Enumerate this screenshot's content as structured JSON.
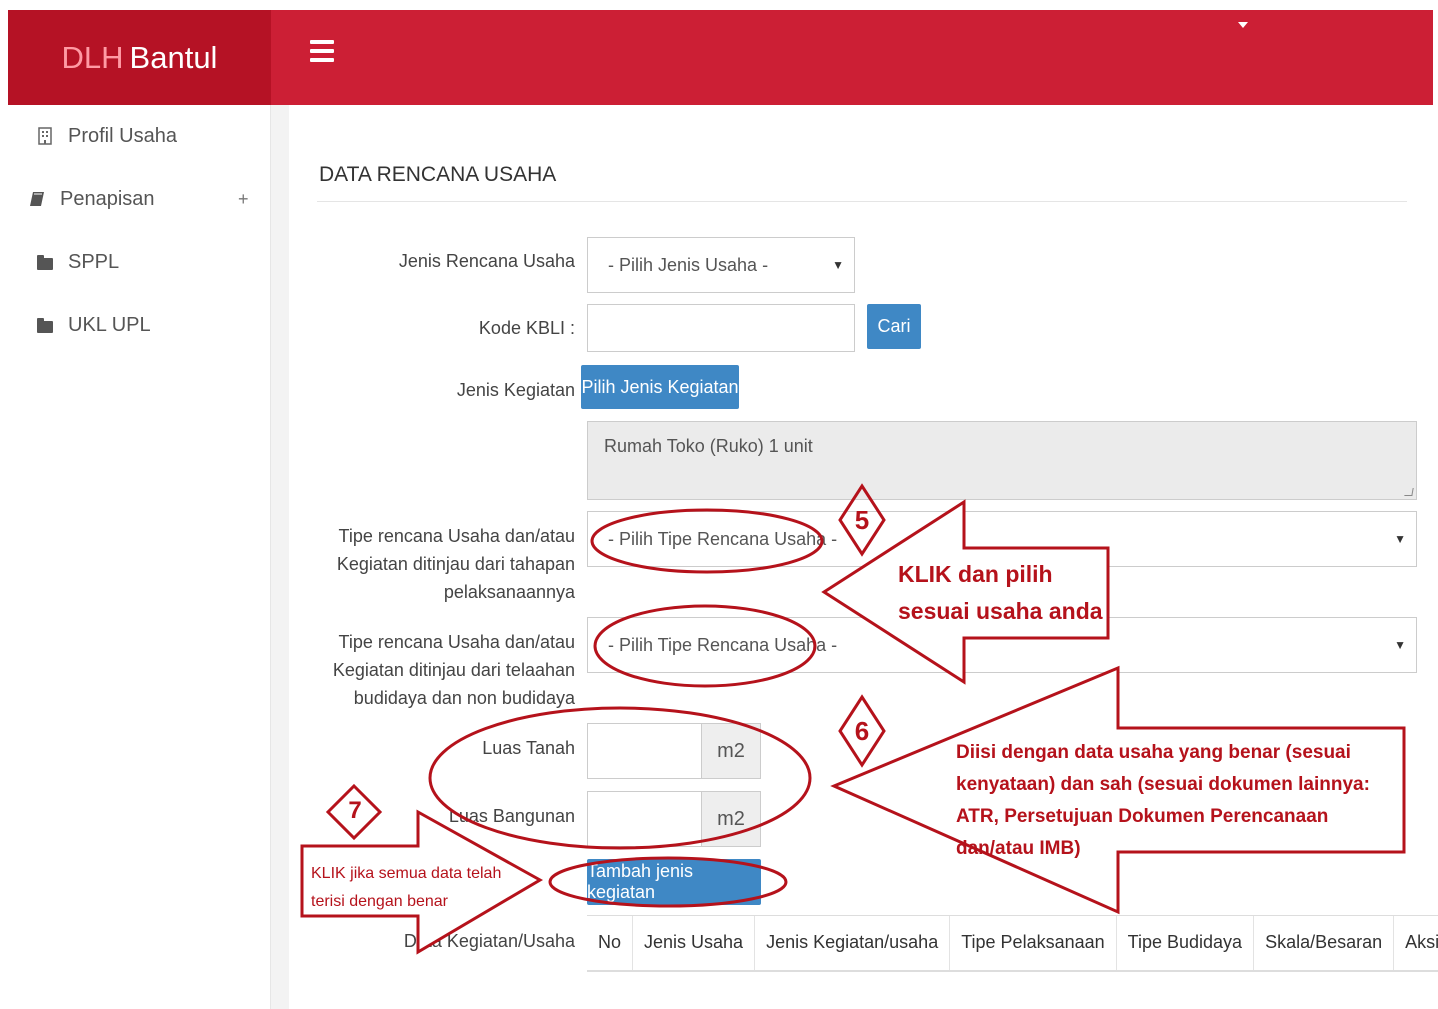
{
  "brand": {
    "part1": "DLH",
    "part2": "Bantul"
  },
  "sidebar": {
    "items": [
      {
        "label": "Profil Usaha",
        "icon": "building-icon"
      },
      {
        "label": "Penapisan",
        "icon": "book-icon",
        "expand": "+"
      },
      {
        "label": "SPPL",
        "icon": "folder-icon"
      },
      {
        "label": "UKL UPL",
        "icon": "folder-icon"
      }
    ]
  },
  "main": {
    "title": "DATA RENCANA USAHA",
    "jenis_rencana": {
      "label": "Jenis Rencana Usaha",
      "value": "- Pilih Jenis Usaha -"
    },
    "kode_kbli": {
      "label": "Kode KBLI :",
      "value": "",
      "button": "Cari"
    },
    "jenis_kegiatan": {
      "label": "Jenis Kegiatan",
      "button": "Pilih Jenis Kegiatan",
      "textarea": "Rumah Toko (Ruko) 1 unit"
    },
    "tipe_tahapan": {
      "label": "Tipe rencana Usaha dan/atau Kegiatan ditinjau dari tahapan pelaksanaannya",
      "value": "- Pilih Tipe Rencana Usaha -"
    },
    "tipe_telaahan": {
      "label": "Tipe rencana Usaha dan/atau Kegiatan ditinjau dari telaahan budidaya dan non budidaya",
      "value": "- Pilih Tipe Rencana Usaha -"
    },
    "luas_tanah": {
      "label": "Luas Tanah",
      "value": "",
      "unit": "m2"
    },
    "luas_bangunan": {
      "label": "Luas Bangunan",
      "value": "",
      "unit": "m2"
    },
    "add_button": "Tambah jenis kegiatan",
    "table": {
      "label": "Data Kegiatan/Usaha",
      "headers": [
        "No",
        "Jenis Usaha",
        "Jenis Kegiatan/usaha",
        "Tipe Pelaksanaan",
        "Tipe Budidaya",
        "Skala/Besaran",
        "Aksi"
      ]
    }
  },
  "annotations": {
    "step5": "5",
    "step5_text": "KLIK dan pilih sesuai usaha anda",
    "step6": "6",
    "step6_text": "Diisi dengan data usaha yang benar (sesuai kenyataan) dan sah (sesuai dokumen lainnya: ATR, Persetujuan Dokumen Perencanaan dan/atau IMB)",
    "step7": "7",
    "step7_text": "KLIK jika semua data telah terisi dengan benar"
  },
  "colors": {
    "header": "#cc1f35",
    "brand_bg": "#b51225",
    "button": "#3f88c5",
    "annotation": "#b5121b"
  }
}
